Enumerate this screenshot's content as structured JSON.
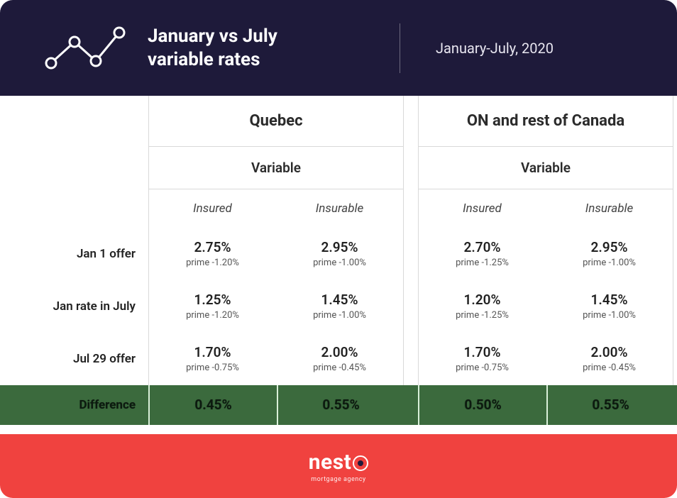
{
  "header": {
    "title_line1": "January vs July",
    "title_line2": "variable rates",
    "date": "January-July, 2020"
  },
  "table": {
    "regions": [
      "Quebec",
      "ON and rest of Canada"
    ],
    "rate_type": "Variable",
    "insurance_types": [
      "Insured",
      "Insurable"
    ],
    "rows": [
      {
        "label": "Jan 1 offer",
        "cells": [
          {
            "rate": "2.75%",
            "prime": "prime -1.20%"
          },
          {
            "rate": "2.95%",
            "prime": "prime -1.00%"
          },
          {
            "rate": "2.70%",
            "prime": "prime -1.25%"
          },
          {
            "rate": "2.95%",
            "prime": "prime -1.00%"
          }
        ]
      },
      {
        "label": "Jan rate in July",
        "cells": [
          {
            "rate": "1.25%",
            "prime": "prime -1.20%"
          },
          {
            "rate": "1.45%",
            "prime": "prime -1.00%"
          },
          {
            "rate": "1.20%",
            "prime": "prime -1.25%"
          },
          {
            "rate": "1.45%",
            "prime": "prime -1.00%"
          }
        ]
      },
      {
        "label": "Jul 29 offer",
        "cells": [
          {
            "rate": "1.70%",
            "prime": "prime -0.75%"
          },
          {
            "rate": "2.00%",
            "prime": "prime -0.45%"
          },
          {
            "rate": "1.70%",
            "prime": "prime -0.75%"
          },
          {
            "rate": "2.00%",
            "prime": "prime -0.45%"
          }
        ]
      }
    ],
    "difference": {
      "label": "Difference",
      "values": [
        "0.45%",
        "0.55%",
        "0.50%",
        "0.55%"
      ]
    }
  },
  "footer": {
    "brand": "nest",
    "tagline": "mortgage agency"
  }
}
